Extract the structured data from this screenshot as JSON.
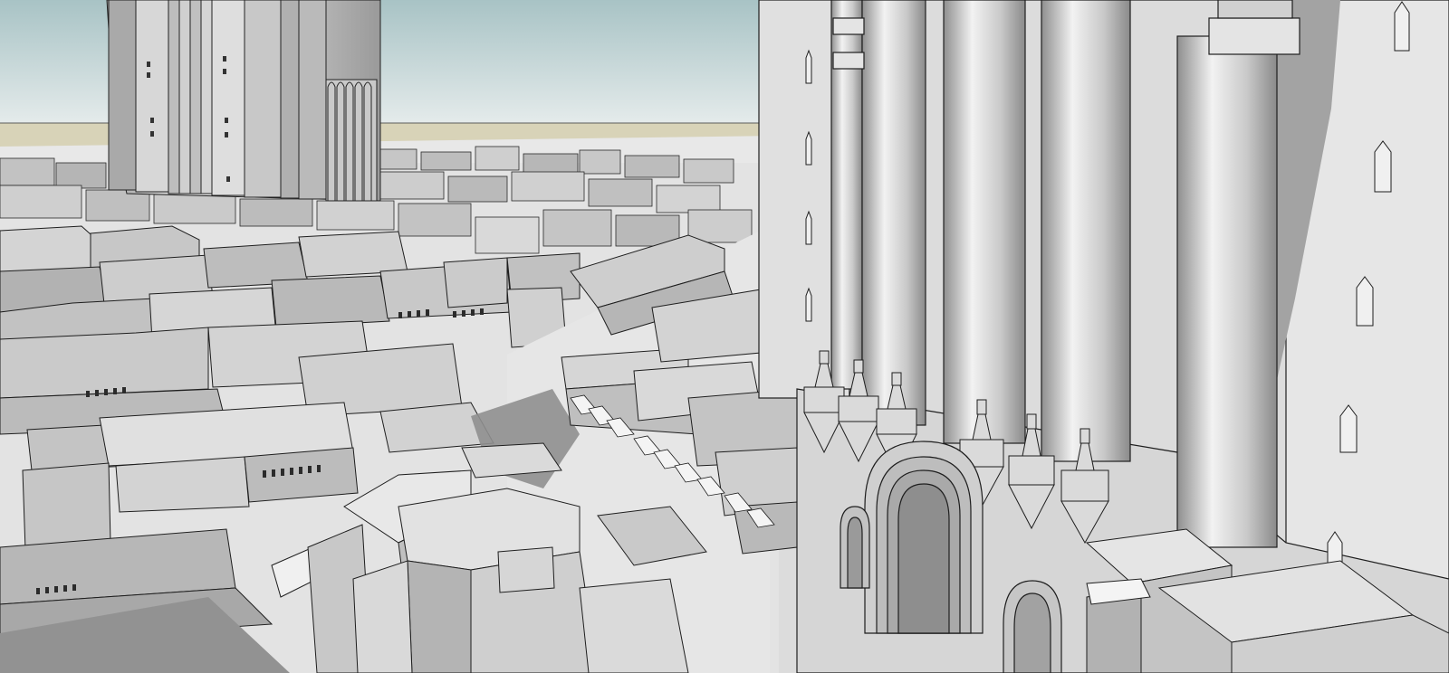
{
  "scene": {
    "description_visible_text": [],
    "palette": {
      "sky_top": "#a9c4c6",
      "sky_bottom": "#e6ecec",
      "horizon_sand": "#d8d3b8",
      "ground": "#e4e4e4",
      "roof_light": "#e2e2e2",
      "wall_mid": "#bdbdbd",
      "wall_dark": "#9e9e9e",
      "shadow": "#8e8e8e",
      "outline": "#1e1e1e"
    }
  }
}
